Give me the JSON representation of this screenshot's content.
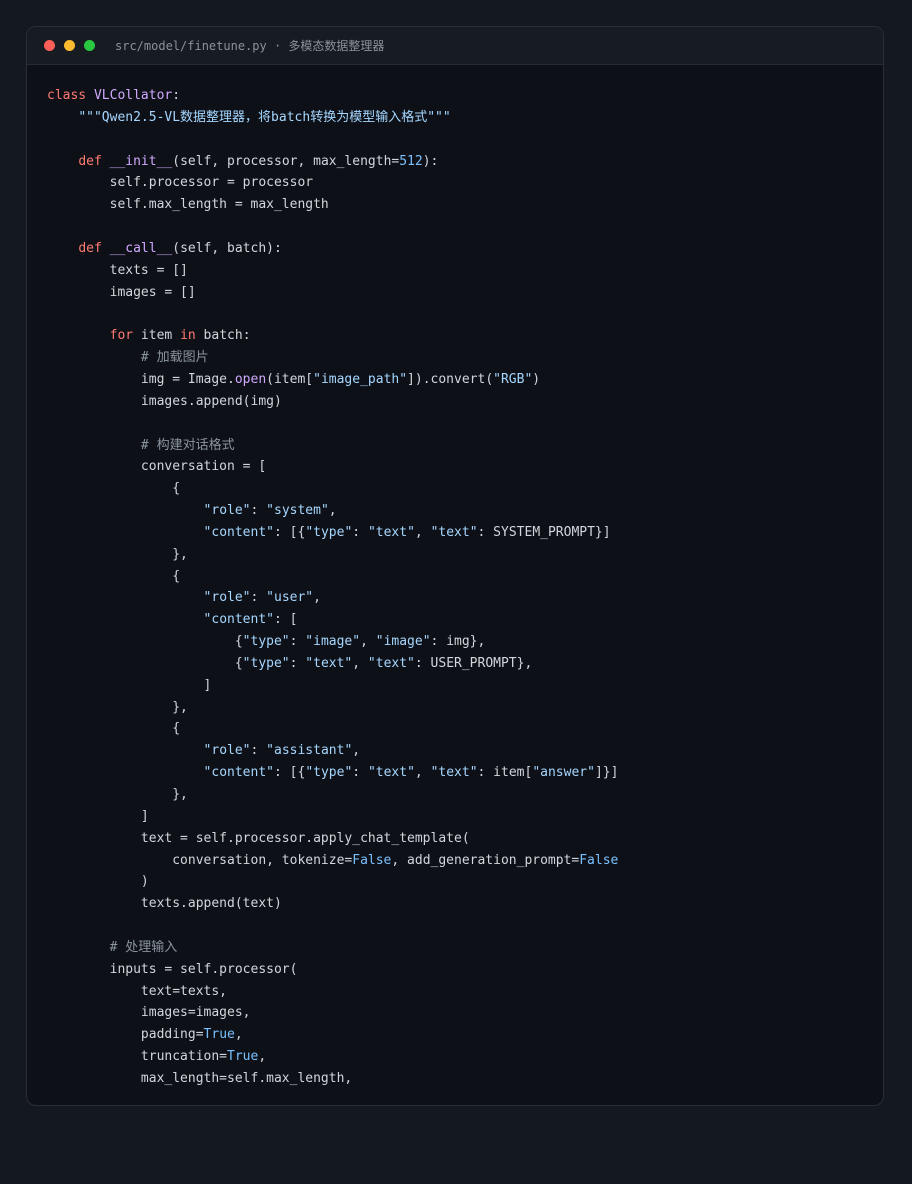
{
  "window": {
    "title": "src/model/finetune.py · 多模态数据整理器",
    "dots": [
      {
        "name": "close",
        "color": "#ff5f57"
      },
      {
        "name": "minimize",
        "color": "#febc2e"
      },
      {
        "name": "maximize",
        "color": "#28c840"
      }
    ]
  },
  "colors": {
    "keyword": "#ff7b72",
    "string": "#a5d6ff",
    "number": "#79c0ff",
    "function": "#d2a8ff",
    "comment": "#8b949e",
    "text": "#d1d6dc"
  },
  "code": {
    "language": "python",
    "lines": [
      [
        [
          "kw",
          "class "
        ],
        [
          "fn",
          "VLCollator"
        ],
        [
          "tx",
          ":"
        ]
      ],
      [
        [
          "tx",
          "    "
        ],
        [
          "str",
          "\"\"\"Qwen2.5-VL数据整理器，将batch转换为模型输入格式\"\"\""
        ]
      ],
      [],
      [
        [
          "tx",
          "    "
        ],
        [
          "kw",
          "def "
        ],
        [
          "fn",
          "__init__"
        ],
        [
          "tx",
          "(self, processor, max_length="
        ],
        [
          "num",
          "512"
        ],
        [
          "tx",
          "):"
        ]
      ],
      [
        [
          "tx",
          "        self.processor = processor"
        ]
      ],
      [
        [
          "tx",
          "        self.max_length = max_length"
        ]
      ],
      [],
      [
        [
          "tx",
          "    "
        ],
        [
          "kw",
          "def "
        ],
        [
          "fn",
          "__call__"
        ],
        [
          "tx",
          "(self, batch):"
        ]
      ],
      [
        [
          "tx",
          "        texts = []"
        ]
      ],
      [
        [
          "tx",
          "        images = []"
        ]
      ],
      [],
      [
        [
          "tx",
          "        "
        ],
        [
          "kw",
          "for"
        ],
        [
          "tx",
          " item "
        ],
        [
          "kw",
          "in"
        ],
        [
          "tx",
          " batch:"
        ]
      ],
      [
        [
          "tx",
          "            "
        ],
        [
          "cm",
          "# 加载图片"
        ]
      ],
      [
        [
          "tx",
          "            img = Image."
        ],
        [
          "fn",
          "open"
        ],
        [
          "tx",
          "(item["
        ],
        [
          "str",
          "\"image_path\""
        ],
        [
          "tx",
          "]).convert("
        ],
        [
          "str",
          "\"RGB\""
        ],
        [
          "tx",
          ")"
        ]
      ],
      [
        [
          "tx",
          "            images.append(img)"
        ]
      ],
      [],
      [
        [
          "tx",
          "            "
        ],
        [
          "cm",
          "# 构建对话格式"
        ]
      ],
      [
        [
          "tx",
          "            conversation = ["
        ]
      ],
      [
        [
          "tx",
          "                {"
        ]
      ],
      [
        [
          "tx",
          "                    "
        ],
        [
          "str",
          "\"role\""
        ],
        [
          "tx",
          ": "
        ],
        [
          "str",
          "\"system\""
        ],
        [
          "tx",
          ","
        ]
      ],
      [
        [
          "tx",
          "                    "
        ],
        [
          "str",
          "\"content\""
        ],
        [
          "tx",
          ": [{"
        ],
        [
          "str",
          "\"type\""
        ],
        [
          "tx",
          ": "
        ],
        [
          "str",
          "\"text\""
        ],
        [
          "tx",
          ", "
        ],
        [
          "str",
          "\"text\""
        ],
        [
          "tx",
          ": SYSTEM_PROMPT}]"
        ]
      ],
      [
        [
          "tx",
          "                },"
        ]
      ],
      [
        [
          "tx",
          "                {"
        ]
      ],
      [
        [
          "tx",
          "                    "
        ],
        [
          "str",
          "\"role\""
        ],
        [
          "tx",
          ": "
        ],
        [
          "str",
          "\"user\""
        ],
        [
          "tx",
          ","
        ]
      ],
      [
        [
          "tx",
          "                    "
        ],
        [
          "str",
          "\"content\""
        ],
        [
          "tx",
          ": ["
        ]
      ],
      [
        [
          "tx",
          "                        {"
        ],
        [
          "str",
          "\"type\""
        ],
        [
          "tx",
          ": "
        ],
        [
          "str",
          "\"image\""
        ],
        [
          "tx",
          ", "
        ],
        [
          "str",
          "\"image\""
        ],
        [
          "tx",
          ": img},"
        ]
      ],
      [
        [
          "tx",
          "                        {"
        ],
        [
          "str",
          "\"type\""
        ],
        [
          "tx",
          ": "
        ],
        [
          "str",
          "\"text\""
        ],
        [
          "tx",
          ", "
        ],
        [
          "str",
          "\"text\""
        ],
        [
          "tx",
          ": USER_PROMPT},"
        ]
      ],
      [
        [
          "tx",
          "                    ]"
        ]
      ],
      [
        [
          "tx",
          "                },"
        ]
      ],
      [
        [
          "tx",
          "                {"
        ]
      ],
      [
        [
          "tx",
          "                    "
        ],
        [
          "str",
          "\"role\""
        ],
        [
          "tx",
          ": "
        ],
        [
          "str",
          "\"assistant\""
        ],
        [
          "tx",
          ","
        ]
      ],
      [
        [
          "tx",
          "                    "
        ],
        [
          "str",
          "\"content\""
        ],
        [
          "tx",
          ": [{"
        ],
        [
          "str",
          "\"type\""
        ],
        [
          "tx",
          ": "
        ],
        [
          "str",
          "\"text\""
        ],
        [
          "tx",
          ", "
        ],
        [
          "str",
          "\"text\""
        ],
        [
          "tx",
          ": item["
        ],
        [
          "str",
          "\"answer\""
        ],
        [
          "tx",
          "]}]"
        ]
      ],
      [
        [
          "tx",
          "                },"
        ]
      ],
      [
        [
          "tx",
          "            ]"
        ]
      ],
      [
        [
          "tx",
          "            text = self.processor.apply_chat_template("
        ]
      ],
      [
        [
          "tx",
          "                conversation, tokenize="
        ],
        [
          "num",
          "False"
        ],
        [
          "tx",
          ", add_generation_prompt="
        ],
        [
          "num",
          "False"
        ]
      ],
      [
        [
          "tx",
          "            )"
        ]
      ],
      [
        [
          "tx",
          "            texts.append(text)"
        ]
      ],
      [],
      [
        [
          "tx",
          "        "
        ],
        [
          "cm",
          "# 处理输入"
        ]
      ],
      [
        [
          "tx",
          "        inputs = self.processor("
        ]
      ],
      [
        [
          "tx",
          "            text=texts,"
        ]
      ],
      [
        [
          "tx",
          "            images=images,"
        ]
      ],
      [
        [
          "tx",
          "            padding="
        ],
        [
          "num",
          "True"
        ],
        [
          "tx",
          ","
        ]
      ],
      [
        [
          "tx",
          "            truncation="
        ],
        [
          "num",
          "True"
        ],
        [
          "tx",
          ","
        ]
      ],
      [
        [
          "tx",
          "            max_length=self.max_length,"
        ]
      ]
    ]
  }
}
